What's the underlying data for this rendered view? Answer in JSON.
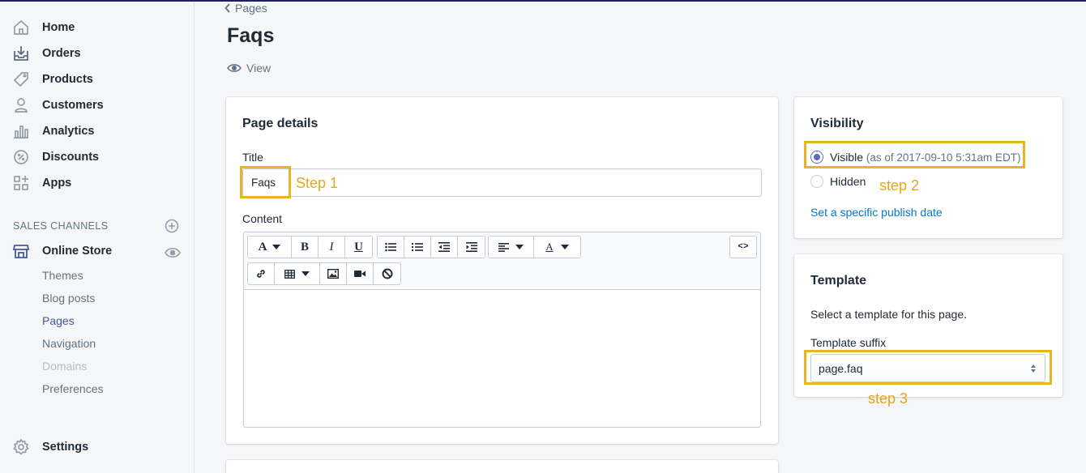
{
  "sidebar": {
    "items": [
      {
        "label": "Home",
        "icon": "home-icon"
      },
      {
        "label": "Orders",
        "icon": "orders-icon"
      },
      {
        "label": "Products",
        "icon": "tag-icon"
      },
      {
        "label": "Customers",
        "icon": "person-icon"
      },
      {
        "label": "Analytics",
        "icon": "bar-chart-icon"
      },
      {
        "label": "Discounts",
        "icon": "discount-icon"
      },
      {
        "label": "Apps",
        "icon": "apps-icon"
      }
    ],
    "sales_channels_heading": "SALES CHANNELS",
    "online_store": "Online Store",
    "sub_items": [
      {
        "label": "Themes",
        "state": "normal"
      },
      {
        "label": "Blog posts",
        "state": "normal"
      },
      {
        "label": "Pages",
        "state": "active"
      },
      {
        "label": "Navigation",
        "state": "normal"
      },
      {
        "label": "Domains",
        "state": "disabled"
      },
      {
        "label": "Preferences",
        "state": "normal"
      }
    ],
    "settings": "Settings"
  },
  "header": {
    "breadcrumb": "Pages",
    "title": "Faqs",
    "view_label": "View"
  },
  "page_details": {
    "heading": "Page details",
    "title_label": "Title",
    "title_value": "Faqs",
    "content_label": "Content",
    "toolbar": {
      "font_label": "A",
      "bold": "B",
      "italic": "I",
      "underline": "U",
      "color_label": "A",
      "html_toggle": "<>"
    }
  },
  "visibility": {
    "heading": "Visibility",
    "visible_label": "Visible",
    "visible_note": "(as of 2017-09-10 5:31am EDT)",
    "hidden_label": "Hidden",
    "selected": "visible",
    "publish_link": "Set a specific publish date"
  },
  "template": {
    "heading": "Template",
    "description": "Select a template for this page.",
    "suffix_label": "Template suffix",
    "suffix_value": "page.faq"
  },
  "annotations": {
    "step1": "Step 1",
    "step2": "step 2",
    "step3": "step 3"
  },
  "colors": {
    "accent": "#5c6ac4",
    "link": "#007ace",
    "highlight": "#e8b426",
    "topbar": "#1c2260"
  }
}
